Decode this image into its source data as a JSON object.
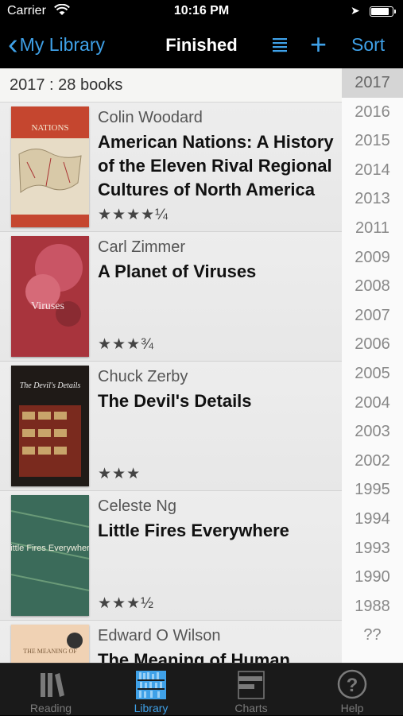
{
  "status": {
    "carrier": "Carrier",
    "time": "10:16 PM"
  },
  "nav": {
    "back_label": "My Library",
    "title": "Finished",
    "add_symbol": "+",
    "sort_label": "Sort"
  },
  "section": {
    "header": "2017 : 28 books"
  },
  "books": [
    {
      "author": "Colin Woodard",
      "title": "American Nations: A History of the Eleven Rival Regional Cultures of North America",
      "rating": "★★★★¼",
      "cover_text": "NATIONS",
      "cover_color": "#c5462f"
    },
    {
      "author": "Carl Zimmer",
      "title": "A Planet of Viruses",
      "rating": "★★★¾",
      "cover_text": "Viruses",
      "cover_color": "#a8343d"
    },
    {
      "author": "Chuck Zerby",
      "title": "The Devil's Details",
      "rating": "★★★",
      "cover_text": "The Devil's Details",
      "cover_color": "#1f1a17"
    },
    {
      "author": "Celeste Ng",
      "title": "Little Fires Everywhere",
      "rating": "★★★½",
      "cover_text": "Little Fires Everywhere",
      "cover_color": "#3b6b5a"
    },
    {
      "author": "Edward O Wilson",
      "title": "The Meaning of Human Existence",
      "rating": "",
      "cover_text": "THE MEANING OF",
      "cover_color": "#f0d2b4"
    }
  ],
  "years": [
    "2017",
    "2016",
    "2015",
    "2014",
    "2013",
    "2011",
    "2009",
    "2008",
    "2007",
    "2006",
    "2005",
    "2004",
    "2003",
    "2002",
    "1995",
    "1994",
    "1993",
    "1990",
    "1988",
    "??"
  ],
  "tabs": [
    {
      "label": "Reading",
      "icon": "reading-icon"
    },
    {
      "label": "Library",
      "icon": "library-icon"
    },
    {
      "label": "Charts",
      "icon": "charts-icon"
    },
    {
      "label": "Help",
      "icon": "help-icon"
    }
  ],
  "colors": {
    "accent": "#3fa1e8",
    "nav_bg": "#000000",
    "tab_bg": "#1a1a1a"
  }
}
